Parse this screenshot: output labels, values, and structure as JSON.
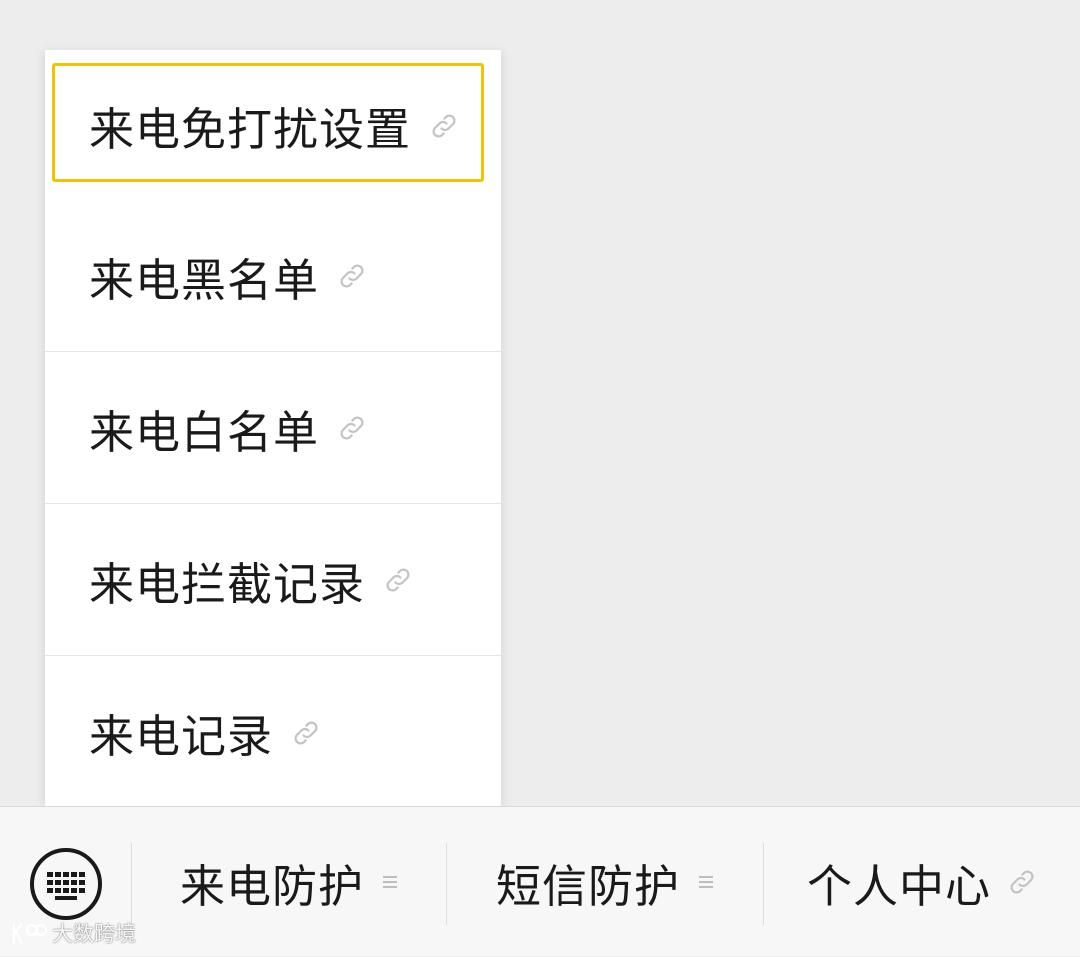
{
  "menu": {
    "items": [
      {
        "label": "来电免打扰设置",
        "icon": "link-icon",
        "selected": true
      },
      {
        "label": "来电黑名单",
        "icon": "link-icon"
      },
      {
        "label": "来电白名单",
        "icon": "link-icon"
      },
      {
        "label": "来电拦截记录",
        "icon": "link-icon"
      },
      {
        "label": "来电记录",
        "icon": "link-icon"
      }
    ]
  },
  "tabbar": {
    "keyboard_icon": "keyboard-icon",
    "tabs": [
      {
        "label": "来电防护",
        "icon": "menu-icon"
      },
      {
        "label": "短信防护",
        "icon": "menu-icon"
      },
      {
        "label": "个人中心",
        "icon": "link-icon"
      }
    ]
  },
  "watermark": {
    "text": "大数跨境"
  },
  "colors": {
    "background": "#ededed",
    "selected_border": "#f2c300",
    "icon_gray": "#c4c4c4"
  }
}
